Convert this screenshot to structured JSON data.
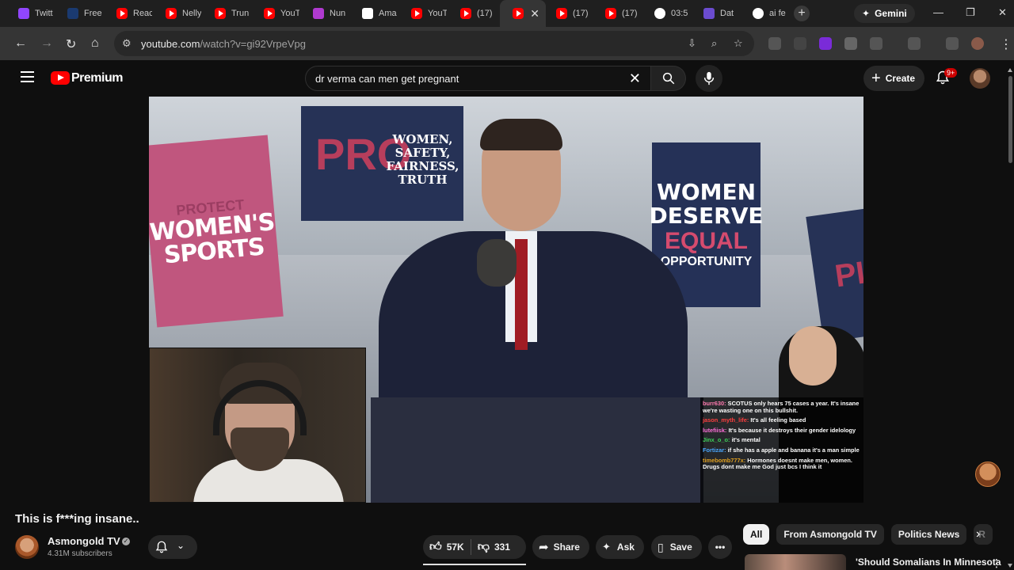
{
  "browser": {
    "tabs": [
      {
        "title": "Twitt",
        "favicon": "twitch-icon",
        "color": "#9146ff"
      },
      {
        "title": "Free",
        "favicon": "j-icon",
        "color": "#1a3a70"
      },
      {
        "title": "Reac",
        "favicon": "youtube-icon",
        "color": "#ff0000"
      },
      {
        "title": "Nelly",
        "favicon": "youtube-icon",
        "color": "#ff0000"
      },
      {
        "title": "Trun",
        "favicon": "youtube-icon",
        "color": "#ff0000"
      },
      {
        "title": "YouT",
        "favicon": "youtube-icon",
        "color": "#ff0000"
      },
      {
        "title": "Nun",
        "favicon": "magenta-icon",
        "color": "#b03ad0"
      },
      {
        "title": "Ama",
        "favicon": "amazon-icon",
        "color": "#ffffff"
      },
      {
        "title": "YouT",
        "favicon": "youtube-icon",
        "color": "#ff0000"
      },
      {
        "title": "(17)",
        "favicon": "youtube-icon",
        "color": "#ff0000"
      },
      {
        "title": "",
        "favicon": "youtube-icon",
        "color": "#ff0000",
        "active": true
      },
      {
        "title": "(17)",
        "favicon": "youtube-icon",
        "color": "#ff0000"
      },
      {
        "title": "(17)",
        "favicon": "youtube-icon",
        "color": "#ff0000"
      },
      {
        "title": "03:5",
        "favicon": "google-icon",
        "color": "#ffffff"
      },
      {
        "title": "Dat",
        "favicon": "notion-icon",
        "color": "#6b4ccf"
      },
      {
        "title": "ai fe",
        "favicon": "google-icon",
        "color": "#ffffff"
      }
    ],
    "new_tab": "+",
    "gemini_label": "Gemini",
    "url_host": "youtube.com",
    "url_path": "/watch?v=gi92VrpeVpg"
  },
  "youtube": {
    "brand": "Premium",
    "search_query": "dr verma can men get pregnant",
    "create_label": "Create",
    "notif_badge": "9+"
  },
  "video": {
    "signs": {
      "left_top": "PROTECT",
      "left_main": "WOMEN'S SPORTS",
      "center_pro": "PRO",
      "center_text": "WOMEN, SAFETY, FAIRNESS, TRUTH",
      "right_main": "WOMEN DESERVE",
      "right_eq": "EQUAL",
      "right_op": "OPPORTUNITY",
      "far_right": "PI"
    },
    "chat": [
      {
        "user": "burr630:",
        "user_color": "#ff7ab0",
        "msg": "SCOTUS only hears 75 cases a year. It's insane we're wasting one on this bullshit."
      },
      {
        "user": "jason_myth_life:",
        "user_color": "#ff3f3f",
        "msg": "It's all feeling based"
      },
      {
        "user": "lutefiisk:",
        "user_color": "#ff6fd8",
        "msg": "It's because it destroys their gender idelology"
      },
      {
        "user": "Jinx_o_o:",
        "user_color": "#3fd15a",
        "msg": "it's mental"
      },
      {
        "user": "Fortizar:",
        "user_color": "#4aa8ff",
        "msg": "if she has a apple and banana it's a man simple"
      },
      {
        "user": "timebomb777x:",
        "user_color": "#e0a020",
        "msg": "Hormones doesnt make men, women. Drugs dont make me God just bcs I think it"
      }
    ]
  },
  "below": {
    "title": "This is f***ing insane..",
    "channel_name": "Asmongold TV",
    "subscribers": "4.31M subscribers",
    "likes": "57K",
    "dislikes": "331",
    "share_label": "Share",
    "ask_label": "Ask",
    "save_label": "Save",
    "chips": [
      "All",
      "From Asmongold TV",
      "Politics News",
      "R"
    ],
    "rec_title": "'Should Somalians In Minnesota"
  }
}
